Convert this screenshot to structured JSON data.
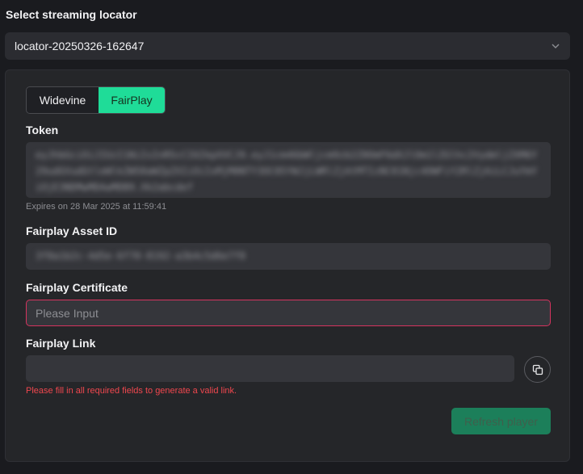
{
  "header": {
    "title": "Select streaming locator"
  },
  "locator_select": {
    "value": "locator-20250326-162647"
  },
  "tabs": [
    {
      "label": "Widevine",
      "active": false
    },
    {
      "label": "FairPlay",
      "active": true
    }
  ],
  "token": {
    "label": "Token",
    "value": "eyJhbGciOiJIUzI1NiIsInR5cCI6IkpXVCJ9.eyJ1cm46bWljcm9zb2Z0OmF6dXJlOm1lZGlhc2VydmljZXM6Y29udGVudGtleWlkZW50aWZpZXIiOiIxMjM0NTY3OC05YWJjLWRlZjAtMTIzNC01Njc4OWFiY2RlZjAiLCJuYmYiOjE3NDMwMDAwMDB9.Xk2abcdef",
    "expires": "Expires on 28 Mar 2025 at 11:59:41"
  },
  "asset_id": {
    "label": "Fairplay Asset ID",
    "value": "3f8a1b2c-4d5e-6f70-8192-a3b4c5d6e7f8"
  },
  "certificate": {
    "label": "Fairplay Certificate",
    "placeholder": "Please Input",
    "value": ""
  },
  "link": {
    "label": "Fairplay Link",
    "value": "",
    "error": "Please fill in all required fields to generate a valid link."
  },
  "actions": {
    "refresh_label": "Refresh player"
  },
  "colors": {
    "accent": "#1fdc98",
    "error": "#f0474e",
    "refresh_bg": "#1c7f5a"
  },
  "icons": {
    "select_chevron": "chevron-down-icon",
    "copy": "copy-icon"
  }
}
